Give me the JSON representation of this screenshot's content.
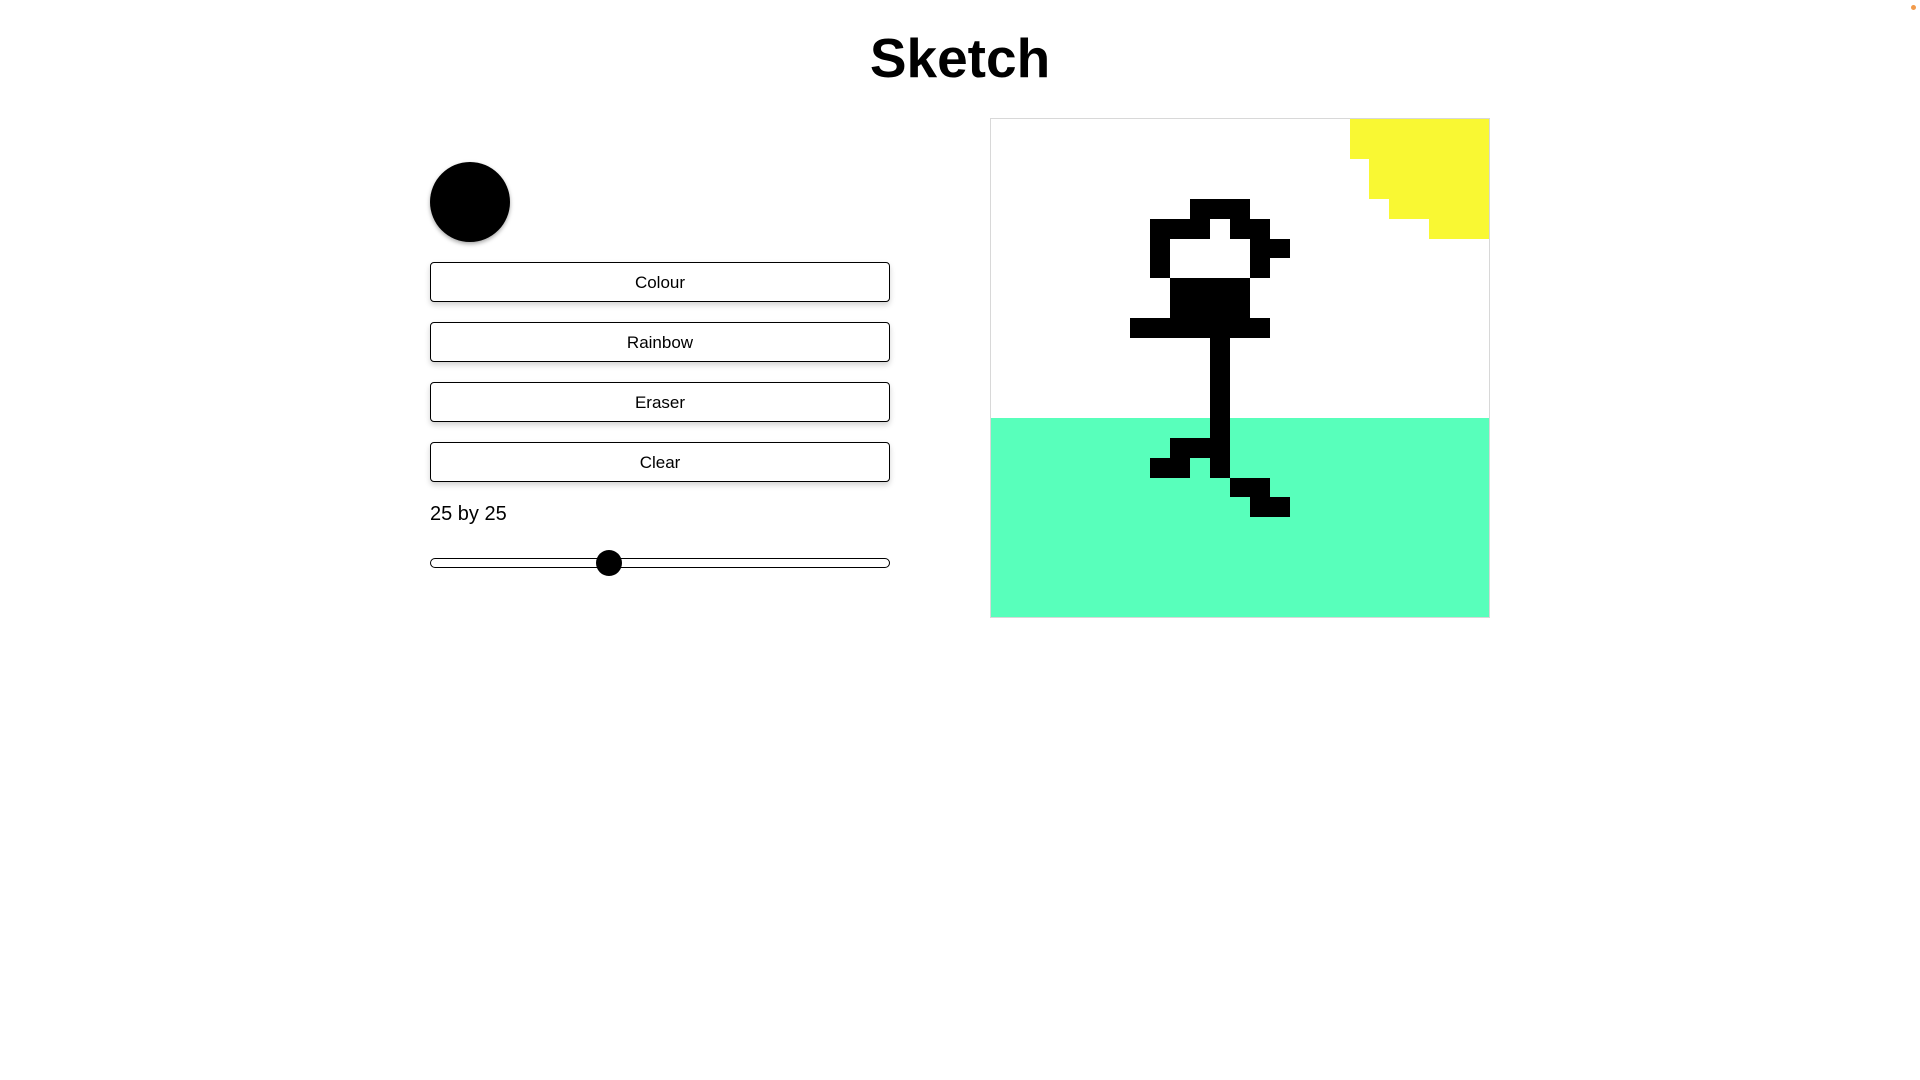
{
  "app": {
    "title": "Sketch"
  },
  "controls": {
    "current_color": "#000000",
    "buttons": [
      {
        "id": "colour",
        "label": "Colour"
      },
      {
        "id": "rainbow",
        "label": "Rainbow"
      },
      {
        "id": "eraser",
        "label": "Eraser"
      },
      {
        "id": "clear",
        "label": "Clear"
      }
    ],
    "grid_size_label": "25 by 25",
    "grid_size": {
      "value": 25,
      "fraction": 0.39
    }
  },
  "canvas": {
    "rows": 25,
    "cols": 25,
    "palette": {
      "W": "#ffffff",
      "K": "#000000",
      "Y": "#f9f833",
      "G": "#58ffbb"
    },
    "pixels": [
      "WWWWWWWWWWWWWWWWWWYYYYYYY",
      "WWWWWWWWWWWWWWWWWWYYYYYYY",
      "WWWWWWWWWWWWWWWWWWWYYYYYY",
      "WWWWWWWWWWWWWWWWWWWYYYYYY",
      "WWWWWWWWWWKKKWWWWWWWYYYYY",
      "WWWWWWWWKKKWKKWWWWWWWWYYY",
      "WWWWWWWWKWWWWKKWWWWWWWWWW",
      "WWWWWWWWKWWWWKWWWWWWWWWWW",
      "WWWWWWWWWKKKKWWWWWWWWWWWW",
      "WWWWWWWWWKKKKWWWWWWWWWWWW",
      "WWWWWWWKKKKKKKWWWWWWWWWWW",
      "WWWWWWWWWWWKWWWWWWWWWWWWW",
      "WWWWWWWWWWWKWWWWWWWWWWWWW",
      "WWWWWWWWWWWKWWWWWWWWWWWWW",
      "WWWWWWWWWWWKWWWWWWWWWWWWW",
      "GGGGGGGGGGGKGGGGGGGGGGGGG",
      "GGGGGGGGGKKKGGGGGGGGGGGGG",
      "GGGGGGGGKKGKGGGGGGGGGGGGG",
      "GGGGGGGGGGGGKKGGGGGGGGGGG",
      "GGGGGGGGGGGGGKKGGGGGGGGGG",
      "GGGGGGGGGGGGGGGGGGGGGGGGG",
      "GGGGGGGGGGGGGGGGGGGGGGGGG",
      "GGGGGGGGGGGGGGGGGGGGGGGGG",
      "GGGGGGGGGGGGGGGGGGGGGGGGG",
      "GGGGGGGGGGGGGGGGGGGGGGGGG"
    ]
  }
}
